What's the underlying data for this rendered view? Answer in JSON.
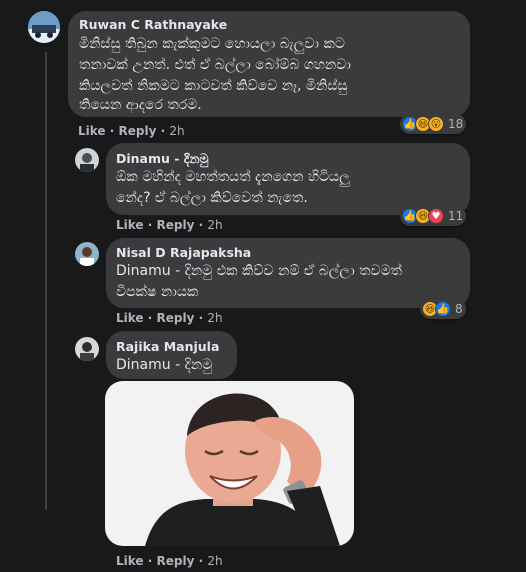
{
  "comments": [
    {
      "author": "Ruwan C Rathnayake",
      "lines": [
        "මිනිස්සු තිබුන කැක්කුමට හොයලා බැලුවා කට",
        "තනාවක් උනත්. එත් ඒ බල්ලා බෝම්බ ගහනවා",
        "කියලවත් නිකමට කාටවත් කිව්වෙ නෑ, මිනිස්සු",
        "තියෙන ආදරෙ තරම."
      ],
      "like": "Like",
      "reply": "Reply",
      "time": "2h",
      "reaction_count": "18",
      "reactions": [
        "like-icon",
        "haha-icon",
        "wow-icon"
      ]
    },
    {
      "author": "Dinamu - දිනමු",
      "lines": [
        "ඕක මහින්ද මහත්තයත් දැනගෙන හිටියලු",
        "නේද? ඒ බල්ලා කිව්වෙත් නැතෙ."
      ],
      "like": "Like",
      "reply": "Reply",
      "time": "2h",
      "reaction_count": "11",
      "reactions": [
        "like-icon",
        "haha-icon",
        "love-icon"
      ]
    },
    {
      "author": "Nisal D Rajapaksha",
      "mention": "Dinamu - දිනමු",
      "lines": [
        " එක කිව්ව නම් ඒ බල්ලා තවමත්",
        "විපක්ෂ නායක"
      ],
      "like": "Like",
      "reply": "Reply",
      "time": "2h",
      "reaction_count": "8",
      "reactions": [
        "haha-icon",
        "like-icon"
      ]
    },
    {
      "author": "Rajika Manjula",
      "mention": "Dinamu - දිනමු",
      "like": "Like",
      "reply": "Reply",
      "time": "2h",
      "photo": "laughing-man-photo"
    }
  ],
  "separator": " · ",
  "colors": {
    "background": "#18191a",
    "bubble": "#3a3b3c",
    "like_blue": "#1877f2",
    "haha_yellow": "#f7b125",
    "love_red": "#f33e58"
  }
}
